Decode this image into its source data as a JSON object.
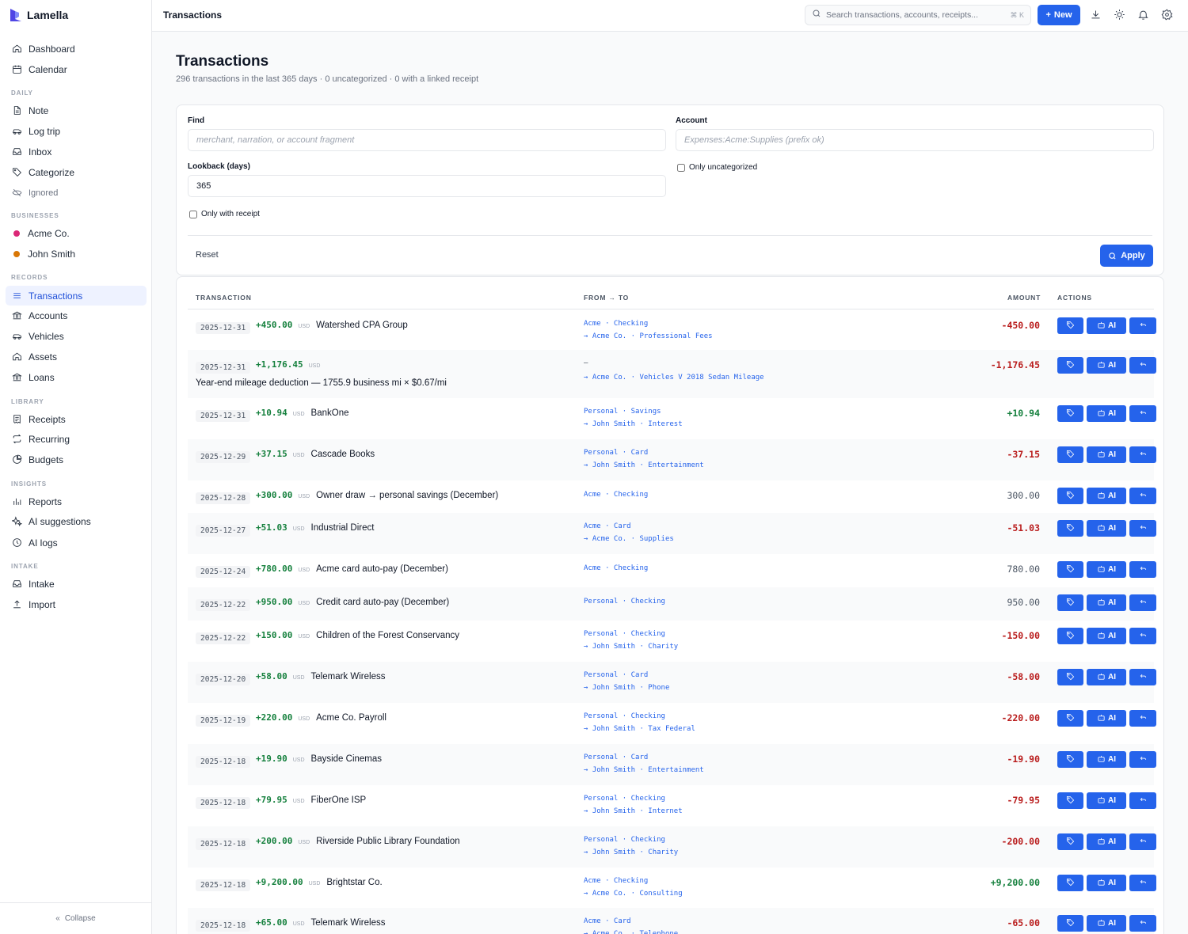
{
  "app": {
    "name": "Lamella"
  },
  "colors": {
    "accent": "#2563eb",
    "positive": "#15803d",
    "negative": "#b91c1c",
    "business_acme": "#db2777",
    "business_john": "#d97706"
  },
  "sidebar": {
    "top": [
      {
        "label": "Dashboard",
        "icon": "home-icon"
      },
      {
        "label": "Calendar",
        "icon": "calendar-icon"
      }
    ],
    "daily_label": "DAILY",
    "daily": [
      {
        "label": "Note",
        "icon": "note-icon"
      },
      {
        "label": "Log trip",
        "icon": "car-icon"
      },
      {
        "label": "Inbox",
        "icon": "inbox-icon"
      },
      {
        "label": "Categorize",
        "icon": "tag-icon"
      },
      {
        "label": "Ignored",
        "icon": "eye-off-icon"
      }
    ],
    "businesses_label": "BUSINESSES",
    "businesses": [
      {
        "label": "Acme Co.",
        "color": "#db2777"
      },
      {
        "label": "John Smith",
        "color": "#d97706"
      }
    ],
    "records_label": "RECORDS",
    "records": [
      {
        "label": "Transactions",
        "icon": "list-icon",
        "active": true
      },
      {
        "label": "Accounts",
        "icon": "bank-icon"
      },
      {
        "label": "Vehicles",
        "icon": "car-icon"
      },
      {
        "label": "Assets",
        "icon": "home-icon"
      },
      {
        "label": "Loans",
        "icon": "bank-icon"
      }
    ],
    "library_label": "LIBRARY",
    "library": [
      {
        "label": "Receipts",
        "icon": "receipt-icon"
      },
      {
        "label": "Recurring",
        "icon": "repeat-icon"
      },
      {
        "label": "Budgets",
        "icon": "pie-icon"
      }
    ],
    "insights_label": "INSIGHTS",
    "insights": [
      {
        "label": "Reports",
        "icon": "bar-chart-icon"
      },
      {
        "label": "AI suggestions",
        "icon": "sparkle-icon"
      },
      {
        "label": "AI logs",
        "icon": "clock-icon"
      }
    ],
    "intake_label": "INTAKE",
    "intake": [
      {
        "label": "Intake",
        "icon": "inbox-icon"
      },
      {
        "label": "Import",
        "icon": "upload-icon"
      }
    ],
    "collapse_label": "Collapse"
  },
  "topbar": {
    "title": "Transactions",
    "search_placeholder": "Search transactions, accounts, receipts...",
    "search_shortcut": "⌘ K",
    "new_label": "New"
  },
  "page": {
    "title": "Transactions",
    "subtitle": "296 transactions in the last 365 days · 0 uncategorized · 0 with a linked receipt"
  },
  "filters": {
    "find_label": "Find",
    "find_placeholder": "merchant, narration, or account fragment",
    "account_label": "Account",
    "account_placeholder": "Expenses:Acme:Supplies (prefix ok)",
    "lookback_label": "Lookback (days)",
    "lookback_value": "365",
    "only_uncategorized_label": "Only uncategorized",
    "only_receipt_label": "Only with receipt",
    "reset_label": "Reset",
    "apply_label": "Apply"
  },
  "table": {
    "headers": {
      "transaction": "TRANSACTION",
      "from_to": "FROM → TO",
      "amount": "AMOUNT",
      "actions": "ACTIONS"
    },
    "ai_label": "AI",
    "currency": "USD",
    "rows": [
      {
        "date": "2025-12-31",
        "amount": "+450.00",
        "name": "Watershed CPA Group",
        "narration": "",
        "from": "Acme · Checking",
        "to": "→ Acme Co. · Professional Fees",
        "signed": "-450.00",
        "sign": "neg"
      },
      {
        "date": "2025-12-31",
        "amount": "+1,176.45",
        "name": "",
        "narration": "Year-end mileage deduction — 1755.9 business mi × $0.67/mi",
        "from": "—",
        "to": "→ Acme Co. · Vehicles V 2018 Sedan Mileage",
        "signed": "-1,176.45",
        "sign": "neg"
      },
      {
        "date": "2025-12-31",
        "amount": "+10.94",
        "name": "BankOne",
        "narration": "",
        "from": "Personal · Savings",
        "to": "→ John Smith · Interest",
        "signed": "+10.94",
        "sign": "pos"
      },
      {
        "date": "2025-12-29",
        "amount": "+37.15",
        "name": "Cascade Books",
        "narration": "",
        "from": "Personal · Card",
        "to": "→ John Smith · Entertainment",
        "signed": "-37.15",
        "sign": "neg"
      },
      {
        "date": "2025-12-28",
        "amount": "+300.00",
        "name": "Owner draw → personal savings (December)",
        "narration": "",
        "from": "Acme · Checking",
        "to": "",
        "signed": "300.00",
        "sign": "neu"
      },
      {
        "date": "2025-12-27",
        "amount": "+51.03",
        "name": "Industrial Direct",
        "narration": "",
        "from": "Acme · Card",
        "to": "→ Acme Co. · Supplies",
        "signed": "-51.03",
        "sign": "neg"
      },
      {
        "date": "2025-12-24",
        "amount": "+780.00",
        "name": "Acme card auto-pay (December)",
        "narration": "",
        "from": "Acme · Checking",
        "to": "",
        "signed": "780.00",
        "sign": "neu"
      },
      {
        "date": "2025-12-22",
        "amount": "+950.00",
        "name": "Credit card auto-pay (December)",
        "narration": "",
        "from": "Personal · Checking",
        "to": "",
        "signed": "950.00",
        "sign": "neu"
      },
      {
        "date": "2025-12-22",
        "amount": "+150.00",
        "name": "Children of the Forest Conservancy",
        "narration": "",
        "from": "Personal · Checking",
        "to": "→ John Smith · Charity",
        "signed": "-150.00",
        "sign": "neg"
      },
      {
        "date": "2025-12-20",
        "amount": "+58.00",
        "name": "Telemark Wireless",
        "narration": "",
        "from": "Personal · Card",
        "to": "→ John Smith · Phone",
        "signed": "-58.00",
        "sign": "neg"
      },
      {
        "date": "2025-12-19",
        "amount": "+220.00",
        "name": "Acme Co. Payroll",
        "narration": "",
        "from": "Personal · Checking",
        "to": "→ John Smith · Tax Federal",
        "signed": "-220.00",
        "sign": "neg"
      },
      {
        "date": "2025-12-18",
        "amount": "+19.90",
        "name": "Bayside Cinemas",
        "narration": "",
        "from": "Personal · Card",
        "to": "→ John Smith · Entertainment",
        "signed": "-19.90",
        "sign": "neg"
      },
      {
        "date": "2025-12-18",
        "amount": "+79.95",
        "name": "FiberOne ISP",
        "narration": "",
        "from": "Personal · Checking",
        "to": "→ John Smith · Internet",
        "signed": "-79.95",
        "sign": "neg"
      },
      {
        "date": "2025-12-18",
        "amount": "+200.00",
        "name": "Riverside Public Library Foundation",
        "narration": "",
        "from": "Personal · Checking",
        "to": "→ John Smith · Charity",
        "signed": "-200.00",
        "sign": "neg"
      },
      {
        "date": "2025-12-18",
        "amount": "+9,200.00",
        "name": "Brightstar Co.",
        "narration": "",
        "from": "Acme · Checking",
        "to": "→ Acme Co. · Consulting",
        "signed": "+9,200.00",
        "sign": "pos"
      },
      {
        "date": "2025-12-18",
        "amount": "+65.00",
        "name": "Telemark Wireless",
        "narration": "",
        "from": "Acme · Card",
        "to": "→ Acme Co. · Telephone",
        "signed": "-65.00",
        "sign": "neg"
      }
    ]
  }
}
